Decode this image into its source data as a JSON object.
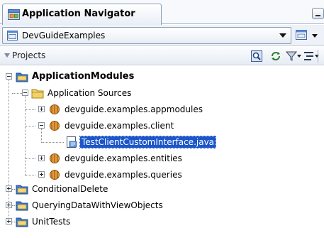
{
  "panel": {
    "title": "Application Navigator",
    "application": "DevGuideExamples",
    "projects_label": "Projects"
  },
  "toolbar": {
    "icons": [
      "filter-icon",
      "sync-icon",
      "funnel-icon",
      "sort-icon"
    ]
  },
  "tree": {
    "nodes": [
      {
        "label": "ApplicationModules",
        "bold": true,
        "expanded": true,
        "icon": "project-folder-icon"
      },
      {
        "label": "Application Sources",
        "expanded": true,
        "icon": "folder-icon"
      },
      {
        "label": "devguide.examples.appmodules",
        "expanded": false,
        "icon": "package-icon"
      },
      {
        "label": "devguide.examples.client",
        "expanded": true,
        "icon": "package-icon"
      },
      {
        "label": "TestClientCustomInterface.java",
        "selected": true,
        "icon": "java-file-icon"
      },
      {
        "label": "devguide.examples.entities",
        "expanded": false,
        "icon": "package-icon"
      },
      {
        "label": "devguide.examples.queries",
        "expanded": false,
        "icon": "package-icon"
      },
      {
        "label": "ConditionalDelete",
        "expanded": false,
        "icon": "project-folder-icon"
      },
      {
        "label": "QueryingDataWithViewObjects",
        "expanded": false,
        "icon": "project-folder-icon"
      },
      {
        "label": "UnitTests",
        "expanded": false,
        "icon": "project-folder-icon"
      }
    ]
  },
  "colors": {
    "selection": "#1c56c9",
    "package": "#d4831c",
    "folder": "#e8c65a",
    "project_folder": "#3a7bd5"
  }
}
